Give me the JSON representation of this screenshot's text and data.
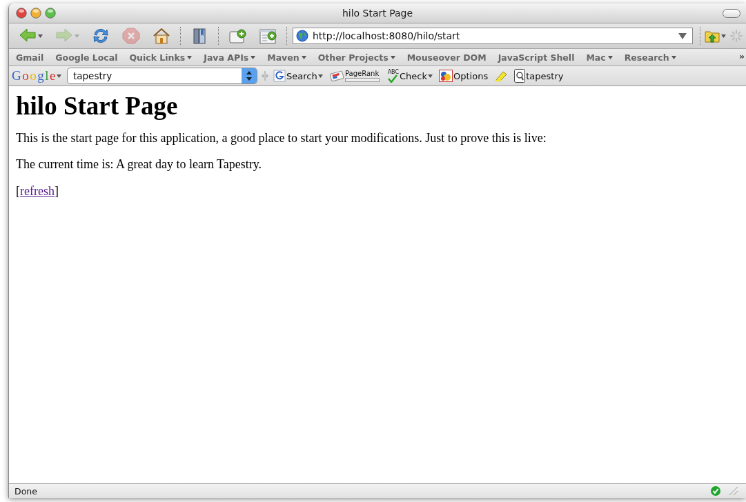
{
  "window": {
    "title": "hilo Start Page"
  },
  "navigation": {
    "buttons": [
      {
        "kind": "back",
        "disabled": false,
        "menu": true
      },
      {
        "kind": "forward",
        "disabled": true,
        "menu": true
      },
      {
        "kind": "reload",
        "disabled": false,
        "menu": false
      },
      {
        "kind": "stop",
        "disabled": true,
        "menu": false
      },
      {
        "kind": "home",
        "disabled": false,
        "menu": false
      },
      {
        "kind": "bookmarks",
        "disabled": false,
        "menu": false
      },
      {
        "kind": "new-window",
        "disabled": false,
        "menu": false
      },
      {
        "kind": "new-tab",
        "disabled": false,
        "menu": false
      }
    ],
    "url": "http://localhost:8080/hilo/start"
  },
  "bookmarks": {
    "items": [
      {
        "label": "Gmail",
        "menu": false
      },
      {
        "label": "Google Local",
        "menu": false
      },
      {
        "label": "Quick Links",
        "menu": true
      },
      {
        "label": "Java APIs",
        "menu": true
      },
      {
        "label": "Maven",
        "menu": true
      },
      {
        "label": "Other Projects",
        "menu": true
      },
      {
        "label": "Mouseover DOM",
        "menu": false
      },
      {
        "label": "JavaScript Shell",
        "menu": false
      },
      {
        "label": "Mac",
        "menu": true
      },
      {
        "label": "Research",
        "menu": true
      }
    ],
    "overflow": "»"
  },
  "google_toolbar": {
    "logo": "Google",
    "query": "tapestry",
    "buttons": [
      {
        "kind": "search",
        "label": "Search",
        "menu": true
      },
      {
        "kind": "pagerank",
        "label": "PageRank",
        "menu": false
      },
      {
        "kind": "check",
        "label": "Check",
        "icon_text": "ABC",
        "menu": true
      },
      {
        "kind": "options",
        "label": "Options",
        "menu": false
      },
      {
        "kind": "highlight",
        "menu": false
      },
      {
        "kind": "term",
        "label": "tapestry",
        "menu": false
      }
    ]
  },
  "page": {
    "heading": "hilo Start Page",
    "paragraphs": [
      "This is the start page for this application, a good place to start your modifications. Just to prove this is live:",
      "The current time is: A great day to learn Tapestry."
    ],
    "refresh": {
      "before": "[",
      "link": "refresh",
      "after": "]"
    }
  },
  "status_bar": {
    "text": "Done"
  }
}
